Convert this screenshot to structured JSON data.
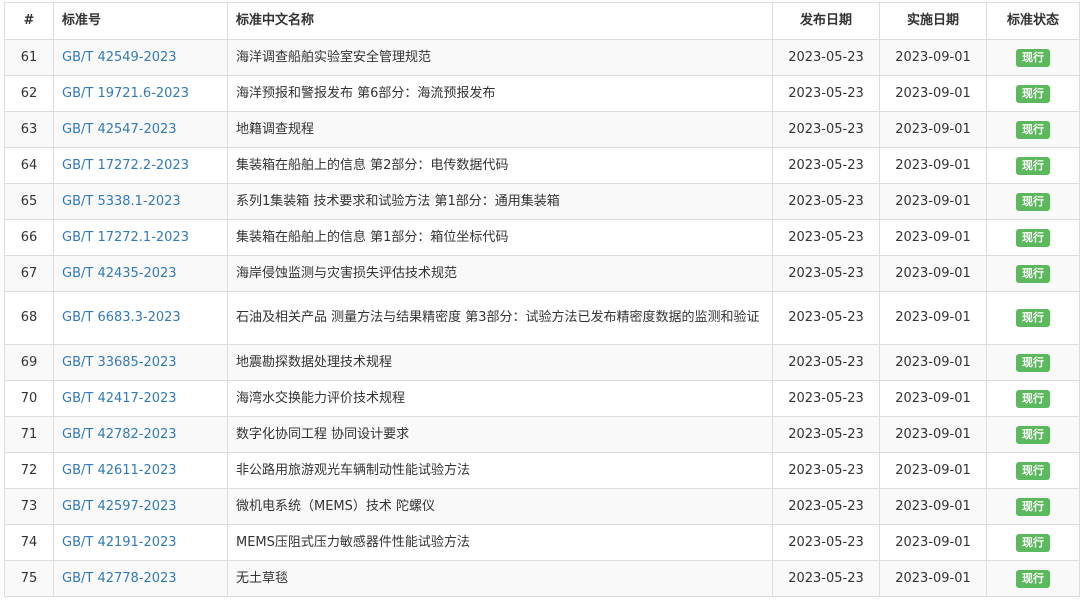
{
  "table": {
    "headers": {
      "num": "#",
      "code": "标准号",
      "name": "标准中文名称",
      "publish": "发布日期",
      "implement": "实施日期",
      "status": "标准状态"
    },
    "status_color": "#5cb85c",
    "link_color": "#337ab7",
    "rows": [
      {
        "num": "61",
        "code": "GB/T 42549-2023",
        "name": "海洋调查船舶实验室安全管理规范",
        "publish": "2023-05-23",
        "implement": "2023-09-01",
        "status": "现行"
      },
      {
        "num": "62",
        "code": "GB/T 19721.6-2023",
        "name": "海洋预报和警报发布 第6部分：海流预报发布",
        "publish": "2023-05-23",
        "implement": "2023-09-01",
        "status": "现行"
      },
      {
        "num": "63",
        "code": "GB/T 42547-2023",
        "name": "地籍调查规程",
        "publish": "2023-05-23",
        "implement": "2023-09-01",
        "status": "现行"
      },
      {
        "num": "64",
        "code": "GB/T 17272.2-2023",
        "name": "集装箱在船舶上的信息 第2部分：电传数据代码",
        "publish": "2023-05-23",
        "implement": "2023-09-01",
        "status": "现行"
      },
      {
        "num": "65",
        "code": "GB/T 5338.1-2023",
        "name": "系列1集装箱 技术要求和试验方法 第1部分：通用集装箱",
        "publish": "2023-05-23",
        "implement": "2023-09-01",
        "status": "现行"
      },
      {
        "num": "66",
        "code": "GB/T 17272.1-2023",
        "name": "集装箱在船舶上的信息 第1部分：箱位坐标代码",
        "publish": "2023-05-23",
        "implement": "2023-09-01",
        "status": "现行"
      },
      {
        "num": "67",
        "code": "GB/T 42435-2023",
        "name": "海岸侵蚀监测与灾害损失评估技术规范",
        "publish": "2023-05-23",
        "implement": "2023-09-01",
        "status": "现行"
      },
      {
        "num": "68",
        "code": "GB/T 6683.3-2023",
        "name": "石油及相关产品 测量方法与结果精密度 第3部分：试验方法已发布精密度数据的监测和验证",
        "publish": "2023-05-23",
        "implement": "2023-09-01",
        "status": "现行"
      },
      {
        "num": "69",
        "code": "GB/T 33685-2023",
        "name": "地震勘探数据处理技术规程",
        "publish": "2023-05-23",
        "implement": "2023-09-01",
        "status": "现行"
      },
      {
        "num": "70",
        "code": "GB/T 42417-2023",
        "name": "海湾水交换能力评价技术规程",
        "publish": "2023-05-23",
        "implement": "2023-09-01",
        "status": "现行"
      },
      {
        "num": "71",
        "code": "GB/T 42782-2023",
        "name": "数字化协同工程 协同设计要求",
        "publish": "2023-05-23",
        "implement": "2023-09-01",
        "status": "现行"
      },
      {
        "num": "72",
        "code": "GB/T 42611-2023",
        "name": "非公路用旅游观光车辆制动性能试验方法",
        "publish": "2023-05-23",
        "implement": "2023-09-01",
        "status": "现行"
      },
      {
        "num": "73",
        "code": "GB/T 42597-2023",
        "name": "微机电系统（MEMS）技术 陀螺仪",
        "publish": "2023-05-23",
        "implement": "2023-09-01",
        "status": "现行"
      },
      {
        "num": "74",
        "code": "GB/T 42191-2023",
        "name": "MEMS压阻式压力敏感器件性能试验方法",
        "publish": "2023-05-23",
        "implement": "2023-09-01",
        "status": "现行"
      },
      {
        "num": "75",
        "code": "GB/T 42778-2023",
        "name": "无土草毯",
        "publish": "2023-05-23",
        "implement": "2023-09-01",
        "status": "现行"
      }
    ]
  }
}
